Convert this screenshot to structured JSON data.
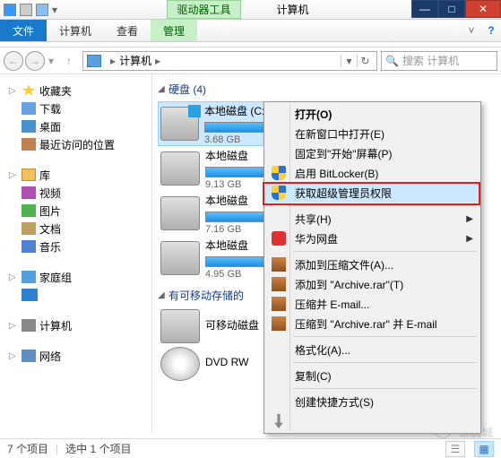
{
  "titlebar": {
    "tool_tab": "驱动器工具",
    "window_title": "计算机"
  },
  "ribbon": {
    "file": "文件",
    "computer": "计算机",
    "view": "查看",
    "manage": "管理"
  },
  "address": {
    "crumb": "计算机",
    "search_placeholder": "搜索 计算机"
  },
  "nav": {
    "favorites": "收藏夹",
    "downloads": "下载",
    "desktop": "桌面",
    "recent": "最近访问的位置",
    "libraries": "库",
    "videos": "视频",
    "pictures": "图片",
    "documents": "文档",
    "music": "音乐",
    "homegroup": "家庭组",
    "computer": "计算机",
    "network": "网络"
  },
  "sections": {
    "hdd": "硬盘 (4)",
    "removable": "有可移动存储的"
  },
  "drives": [
    {
      "name": "本地磁盘 (C:)",
      "free": "3.68 GB",
      "fill_pct": 85,
      "selected": true,
      "win": true
    },
    {
      "name": "本地磁盘",
      "free": "9.13 GB",
      "fill_pct": 70
    },
    {
      "name": "本地磁盘",
      "free": "7.16 GB",
      "fill_pct": 75
    },
    {
      "name": "本地磁盘",
      "free": "4.95 GB",
      "fill_pct": 80
    }
  ],
  "removable": [
    {
      "name": "可移动磁盘"
    },
    {
      "name": "DVD RW"
    }
  ],
  "context_menu": {
    "open": "打开(O)",
    "open_new_window": "在新窗口中打开(E)",
    "pin_start": "固定到\"开始\"屏幕(P)",
    "bitlocker": "启用 BitLocker(B)",
    "get_admin": "获取超级管理员权限",
    "share": "共享(H)",
    "huawei": "华为网盘",
    "add_archive": "添加到压缩文件(A)...",
    "add_archive_rar": "添加到 \"Archive.rar\"(T)",
    "compress_email": "压缩并 E-mail...",
    "compress_rar_email": "压缩到 \"Archive.rar\" 并 E-mail",
    "format": "格式化(A)...",
    "copy": "复制(C)",
    "create_shortcut": "创建快捷方式(S)"
  },
  "status": {
    "items": "7 个项目",
    "selected": "选中 1 个项目"
  },
  "watermark": "系统城"
}
